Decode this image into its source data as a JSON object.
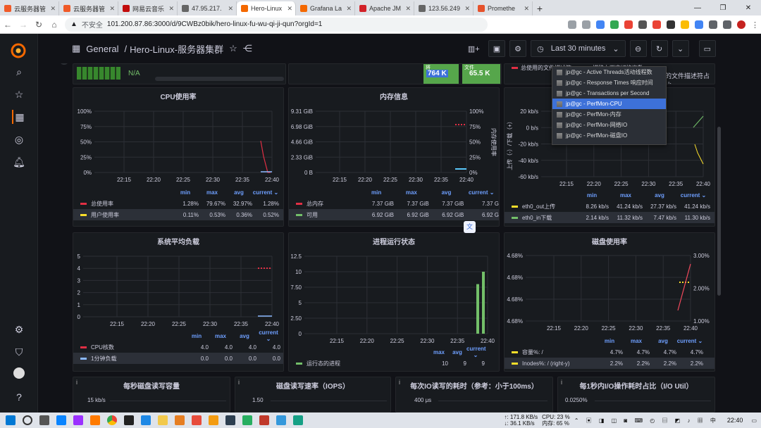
{
  "browser": {
    "tabs": [
      {
        "label": "云服务器管",
        "fav": "#f05a28"
      },
      {
        "label": "云服务器管",
        "fav": "#f05a28"
      },
      {
        "label": "网易云音乐",
        "fav": "#c20c0c"
      },
      {
        "label": "47.95.217.",
        "fav": "#666"
      },
      {
        "label": "Hero-Linux",
        "fav": "#f46800",
        "active": true
      },
      {
        "label": "Grafana La",
        "fav": "#f46800"
      },
      {
        "label": "Apache JM",
        "fav": "#d22128"
      },
      {
        "label": "123.56.249",
        "fav": "#666"
      },
      {
        "label": "Promethe",
        "fav": "#e6522c"
      }
    ],
    "insecure": "不安全",
    "url": "101.200.87.86:3000/d/9CWBz0bik/hero-linux-fu-wu-qi-ji-qun?orgId=1"
  },
  "dashboard": {
    "folder": "General",
    "separator": "/",
    "title": "Hero-Linux-服务器集群",
    "time_range": "Last 30 minutes"
  },
  "top_strip": {
    "na": "N/A",
    "stat1_value": "764 K",
    "stat1_label": "将",
    "stat2_value": "65.5 K",
    "stat2_label": "文件",
    "legend_a": "总使用的文件描述符",
    "legend_b": "描移上下文切换次数",
    "right_text": "的文件描述符占比"
  },
  "cpu": {
    "title": "CPU使用率",
    "yticks": [
      "100%",
      "75%",
      "50%",
      "25%",
      "0%"
    ],
    "xticks": [
      "22:15",
      "22:20",
      "22:25",
      "22:30",
      "22:35",
      "22:40"
    ],
    "headers": [
      "min",
      "max",
      "avg",
      "current"
    ],
    "rows": [
      {
        "name": "总使用率",
        "color": "#e02f44",
        "min": "1.28%",
        "max": "79.67%",
        "avg": "32.97%",
        "current": "1.28%"
      },
      {
        "name": "用户使用率",
        "color": "#fade2a",
        "min": "0.11%",
        "max": "0.53%",
        "avg": "0.36%",
        "current": "0.52%",
        "hl": true
      }
    ]
  },
  "mem": {
    "title": "内存信息",
    "yticks": [
      "9.31 GiB",
      "6.98 GiB",
      "4.66 GiB",
      "2.33 GiB",
      "0 B"
    ],
    "y2ticks": [
      "100%",
      "75%",
      "50%",
      "25%",
      "0%"
    ],
    "y2label": "内存使用率",
    "xticks": [
      "22:15",
      "22:20",
      "22:25",
      "22:30",
      "22:35",
      "22:40"
    ],
    "headers": [
      "min",
      "max",
      "avg",
      "current"
    ],
    "rows": [
      {
        "name": "总内存",
        "color": "#e02f44",
        "min": "7.37 GiB",
        "max": "7.37 GiB",
        "avg": "7.37 GiB",
        "current": "7.37 G"
      },
      {
        "name": "可用",
        "color": "#73bf69",
        "min": "6.92 GiB",
        "max": "6.92 GiB",
        "avg": "6.92 GiB",
        "current": "6.92 G",
        "hl": true
      }
    ]
  },
  "net": {
    "yticks": [
      "20 kb/s",
      "0 b/s",
      "-20 kb/s",
      "-40 kb/s",
      "-60 kb/s"
    ],
    "ylabel": "上传（-）/下载（+）",
    "xticks": [
      "22:15",
      "22:20",
      "22:25",
      "22:30",
      "22:35",
      "22:40"
    ],
    "headers": [
      "min",
      "max",
      "avg",
      "current"
    ],
    "rows": [
      {
        "name": "eth0_out上传",
        "color": "#fade2a",
        "min": "8.26 kb/s",
        "max": "41.24 kb/s",
        "avg": "27.37 kb/s",
        "current": "41.24 kb/s"
      },
      {
        "name": "eth0_in下载",
        "color": "#73bf69",
        "min": "2.14 kb/s",
        "max": "11.32 kb/s",
        "avg": "7.47 kb/s",
        "current": "11.30 kb/s",
        "hl": true
      }
    ]
  },
  "dropdown": {
    "items": [
      "jp@gc - Active Threads活动线程数",
      "jp@gc - Response Times 响应时间",
      "jp@gc - Transactions per Second",
      "jp@gc - PerfMon-CPU",
      "jp@gc - PerfMon-内存",
      "jp@gc - PerfMon-网络IO",
      "jp@gc - PerfMon-磁盘IO"
    ],
    "selected_index": 3
  },
  "load": {
    "title": "系统平均负载",
    "yticks": [
      "5",
      "4",
      "3",
      "2",
      "1",
      "0"
    ],
    "xticks": [
      "22:15",
      "22:20",
      "22:25",
      "22:30",
      "22:35",
      "22:40"
    ],
    "headers": [
      "min",
      "max",
      "avg",
      "current"
    ],
    "rows": [
      {
        "name": "CPU核数",
        "color": "#e02f44",
        "min": "4.0",
        "max": "4.0",
        "avg": "4.0",
        "current": "4.0"
      },
      {
        "name": "1分钟负载",
        "color": "#8ab8ff",
        "min": "0.0",
        "max": "0.0",
        "avg": "0.0",
        "current": "0.0",
        "hl": true
      }
    ]
  },
  "proc": {
    "title": "进程运行状态",
    "yticks": [
      "12.5",
      "10",
      "7.50",
      "5",
      "2.50",
      "0"
    ],
    "xticks": [
      "22:15",
      "22:20",
      "22:25",
      "22:30",
      "22:35",
      "22:40"
    ],
    "headers": [
      "max",
      "avg",
      "current"
    ],
    "rows": [
      {
        "name": "运行态的进程",
        "color": "#73bf69",
        "max": "10",
        "avg": "9",
        "current": "9"
      }
    ]
  },
  "disk": {
    "title": "磁盘使用率",
    "yticks": [
      "4.68%",
      "4.68%",
      "4.68%",
      "4.68%"
    ],
    "y2ticks": [
      "3.00%",
      "2.00%",
      "1.00%"
    ],
    "xticks": [
      "22:15",
      "22:20",
      "22:25",
      "22:30",
      "22:35",
      "22:40"
    ],
    "headers": [
      "min",
      "max",
      "avg",
      "current"
    ],
    "rows": [
      {
        "name": "容量%: /",
        "color": "#fade2a",
        "min": "4.7%",
        "max": "4.7%",
        "avg": "4.7%",
        "current": "4.7%"
      },
      {
        "name": "Inodes%: / (right-y)",
        "color": "#fade2a",
        "min": "2.2%",
        "max": "2.2%",
        "avg": "2.2%",
        "current": "2.2%",
        "hl": true
      }
    ]
  },
  "bottom": {
    "p1_title": "每秒磁盘读写容量",
    "p1_tick": "15 kb/s",
    "p2_title": "磁盘读写速率（IOPS）",
    "p2_tick": "1.50",
    "p3_title": "每次IO读写的耗时（参考：小于100ms）",
    "p3_tick": "400 μs",
    "p4_title": "每1秒内I/O操作耗时占比（I/O Util）",
    "p4_tick": "0.0250%"
  },
  "taskbar": {
    "net_up": "↑: 171.8 KB/s",
    "net_down": "↓: 36.1 KB/s",
    "cpu": "CPU: 23 %",
    "mem": "内存: 65 %",
    "clock": "22:40"
  }
}
